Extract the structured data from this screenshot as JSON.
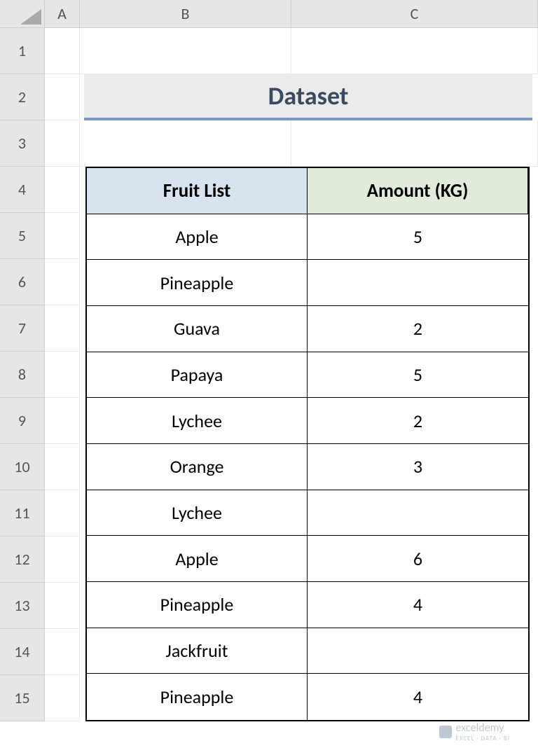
{
  "columns": [
    "A",
    "B",
    "C"
  ],
  "rows": [
    "1",
    "2",
    "3",
    "4",
    "5",
    "6",
    "7",
    "8",
    "9",
    "10",
    "11",
    "12",
    "13",
    "14",
    "15"
  ],
  "title": "Dataset",
  "table": {
    "headers": [
      "Fruit List",
      "Amount (KG)"
    ],
    "data": [
      {
        "fruit": "Apple",
        "amount": "5"
      },
      {
        "fruit": "Pineapple",
        "amount": ""
      },
      {
        "fruit": "Guava",
        "amount": "2"
      },
      {
        "fruit": "Papaya",
        "amount": "5"
      },
      {
        "fruit": "Lychee",
        "amount": "2"
      },
      {
        "fruit": "Orange",
        "amount": "3"
      },
      {
        "fruit": "Lychee",
        "amount": ""
      },
      {
        "fruit": "Apple",
        "amount": "6"
      },
      {
        "fruit": "Pineapple",
        "amount": "4"
      },
      {
        "fruit": "Jackfruit",
        "amount": ""
      },
      {
        "fruit": "Pineapple",
        "amount": "4"
      }
    ]
  },
  "watermark": {
    "brand": "exceldemy",
    "tag": "EXCEL · DATA · BI"
  }
}
